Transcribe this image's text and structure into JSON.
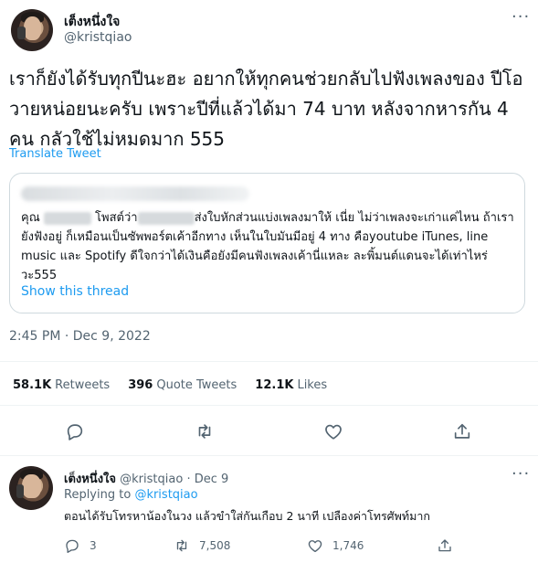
{
  "tweet": {
    "author_name": "เต็งหนึ่งใจ",
    "author_handle": "@kristqiao",
    "text": "เราก็ยังได้รับทุกปีนะฮะ อยากให้ทุกคนช่วยกลับไปฟังเพลงของ ปีโอวายหน่อยนะครับ เพราะปีที่แล้วได้มา 74 บาท หลังจากหารกัน 4 คน กลัวใช้ไม่หมดมาก 555",
    "translate_label": "Translate Tweet",
    "quote": {
      "text_part1": "คุณ",
      "text_part2": "โพสต์ว่า",
      "text_part3": "ส่งใบหักส่วนแบ่งเพลงมาให้ เนี่ย ไม่ว่าเพลงจะเก่าแค่ไหน ถ้าเรายังฟังอยู่ ก็เหมือนเป็นซัพพอร์ตเค้าอีกทาง เห็นในใบมันมีอยู่ 4 ทาง คือyoutube iTunes, line music และ Spotify ดีใจกว่าได้เงินคือยังมีคนฟังเพลงเค้านี่แหละ ละพิ้มนต์แดนจะได้เท่าไหร่วะ555",
      "show_thread_label": "Show this thread"
    },
    "timestamp": "2:45 PM · Dec 9, 2022",
    "stats": {
      "retweets_count": "58.1K",
      "retweets_label": "Retweets",
      "quotes_count": "396",
      "quotes_label": "Quote Tweets",
      "likes_count": "12.1K",
      "likes_label": "Likes"
    }
  },
  "reply": {
    "author_name": "เต็งหนึ่งใจ",
    "author_handle": "@kristqiao",
    "date": "· Dec 9",
    "replying_label": "Replying to",
    "replying_handle": "@kristqiao",
    "text": "ตอนได้รับโทรหาน้องในวง แล้วขำใส่กันเกือบ 2 นาที เปลืองค่าโทรศัพท์มาก",
    "reply_count": "3",
    "retweet_count": "7,508",
    "like_count": "1,746"
  },
  "icons": {
    "reply": "reply-icon",
    "retweet": "retweet-icon",
    "like": "heart-icon",
    "share": "share-icon",
    "more": "more-icon"
  },
  "colors": {
    "accent": "#1d9bf0",
    "secondary_text": "#536471",
    "border": "#cfd9de"
  }
}
